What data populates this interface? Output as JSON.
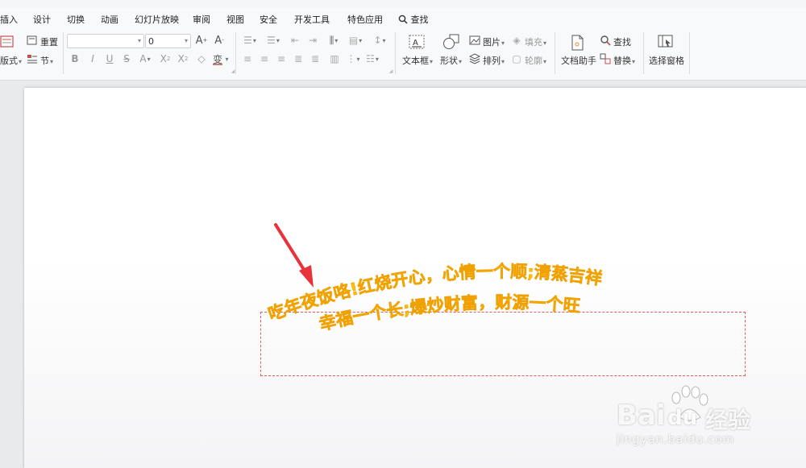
{
  "menu": {
    "items": [
      "插入",
      "设计",
      "切换",
      "动画",
      "幻灯片放映",
      "审阅",
      "视图",
      "安全",
      "开发工具",
      "特色应用"
    ],
    "search_label": "查找"
  },
  "ribbon": {
    "layout_label": "版式",
    "reset_label": "重置",
    "section_label": "节",
    "font_name_value": "",
    "font_size_value": "0",
    "textbox_label": "文本框",
    "shape_label": "形状",
    "picture_label": "图片",
    "fill_label": "填充",
    "arrange_label": "排列",
    "outline_label": "轮廓",
    "doc_helper_label": "文档助手",
    "find_label": "查找",
    "replace_label": "替换",
    "selection_pane_label": "选择窗格"
  },
  "slide": {
    "arc_text_line1": "吃年夜饭咯!红烧开心，心情一个顺;清蒸吉祥",
    "arc_text_line2": "幸福一个长;爆炒财富，财源一个旺",
    "text_color": "#ffc000",
    "text_stroke": "#f0a800"
  },
  "watermark": {
    "brand_1": "Bai",
    "brand_2": "du",
    "brand_3": "经验",
    "url": "jingyan.baidu.com"
  },
  "colors": {
    "arrow": "#e8323c",
    "selection_border": "#e25a5a"
  }
}
